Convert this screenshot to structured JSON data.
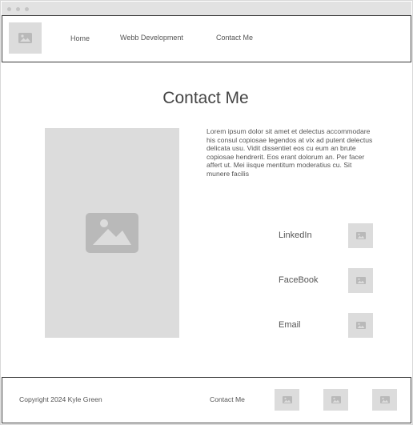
{
  "window": {
    "titlebar_dots": [
      "window-dot",
      "window-dot",
      "window-dot"
    ]
  },
  "header": {
    "logo_icon": "image-icon",
    "nav": [
      {
        "label": "Home"
      },
      {
        "label": "Webb Development"
      },
      {
        "label": "Contact Me"
      }
    ]
  },
  "main": {
    "title": "Contact Me",
    "hero_icon": "image-icon",
    "body_text": "Lorem ipsum dolor sit amet et delectus accommodare his consul copiosae legendos at vix ad putent delectus delicata usu. Vidit dissentiet eos cu eum an brute copiosae hendrerit. Eos erant dolorum an. Per facer affert ut. Mei iisque mentitum moderatius cu. Sit munere facilis",
    "socials": [
      {
        "label": "LinkedIn",
        "icon": "image-icon"
      },
      {
        "label": "FaceBook",
        "icon": "image-icon"
      },
      {
        "label": "Email",
        "icon": "image-icon"
      }
    ]
  },
  "footer": {
    "copyright": "Copyright 2024 Kyle Green",
    "contact_link": "Contact Me",
    "icons": [
      "image-icon",
      "image-icon",
      "image-icon"
    ]
  },
  "colors": {
    "placeholder": "#dcdcdc",
    "placeholder_icon": "#b9b9b9",
    "border": "#3a3a3a",
    "text": "#444444"
  }
}
